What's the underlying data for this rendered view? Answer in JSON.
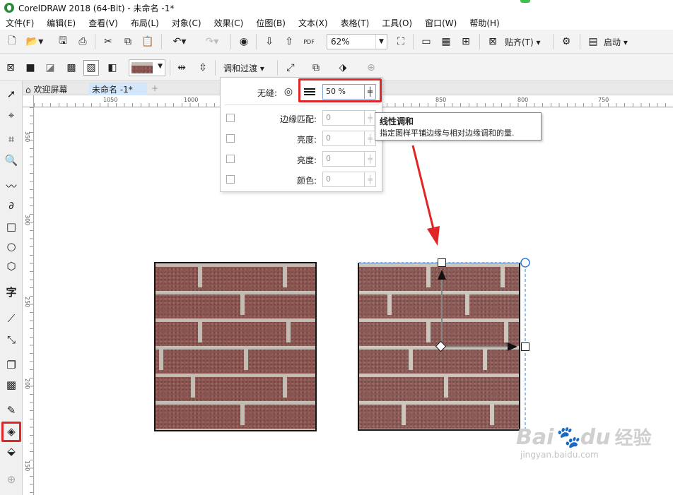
{
  "window": {
    "title": "CorelDRAW 2018 (64-Bit) - 未命名 -1*"
  },
  "menu": [
    "文件(F)",
    "编辑(E)",
    "查看(V)",
    "布局(L)",
    "对象(C)",
    "效果(C)",
    "位图(B)",
    "文本(X)",
    "表格(T)",
    "工具(O)",
    "窗口(W)",
    "帮助(H)"
  ],
  "standard_toolbar": {
    "zoom": "62%",
    "snap_label": "贴齐(T)",
    "launch_label": "启动",
    "pdf_label": "PDF"
  },
  "property_bar": {
    "blend_label": "调和过渡"
  },
  "tabs": {
    "welcome": "欢迎屏幕",
    "document": "未命名 -1*"
  },
  "ruler": {
    "h_labels": [
      "1050",
      "1000",
      "850",
      "800",
      "750"
    ],
    "v_labels": [
      "350",
      "300",
      "250",
      "200",
      "150"
    ]
  },
  "popup": {
    "seamless_label": "无缝:",
    "seamless_value": "50 %",
    "rows": [
      {
        "label": "边缘匹配:",
        "value": "0"
      },
      {
        "label": "亮度:",
        "value": "0"
      },
      {
        "label": "亮度:",
        "value": "0"
      },
      {
        "label": "颜色:",
        "value": "0"
      }
    ]
  },
  "tooltip": {
    "title": "线性调和",
    "description": "指定图样平铺边缘与相对边缘调和的量."
  },
  "watermark": {
    "brand": "Bai",
    "brand2": "经验",
    "url": "jingyan.baidu.com"
  },
  "colors": {
    "highlight": "#e02626",
    "brick": "#8e5550",
    "selection": "#2a7fd4"
  }
}
